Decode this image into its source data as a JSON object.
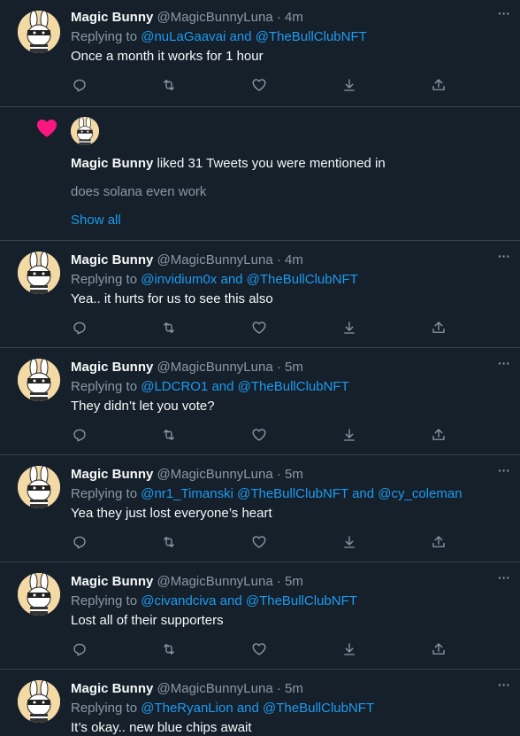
{
  "tweets": [
    {
      "name": "Magic Bunny",
      "handle": "@MagicBunnyLuna",
      "dot": " · ",
      "time": "4m",
      "replying_prefix": "Replying to ",
      "replying_to": "@nuLaGaavai and @TheBullClubNFT",
      "text": "Once a month it works for 1 hour"
    },
    {
      "name": "Magic Bunny",
      "handle": "@MagicBunnyLuna",
      "dot": " · ",
      "time": "4m",
      "replying_prefix": "Replying to ",
      "replying_to": "@invidium0x and @TheBullClubNFT",
      "text": "Yea.. it hurts for us to see this also"
    },
    {
      "name": "Magic Bunny",
      "handle": "@MagicBunnyLuna",
      "dot": " · ",
      "time": "5m",
      "replying_prefix": "Replying to ",
      "replying_to": "@LDCRO1 and @TheBullClubNFT",
      "text": "They didn’t let you vote?"
    },
    {
      "name": "Magic Bunny",
      "handle": "@MagicBunnyLuna",
      "dot": " · ",
      "time": "5m",
      "replying_prefix": "Replying to ",
      "replying_to": "@nr1_Timanski @TheBullClubNFT and @cy_coleman",
      "text": "Yea they just lost everyone’s heart"
    },
    {
      "name": "Magic Bunny",
      "handle": "@MagicBunnyLuna",
      "dot": " · ",
      "time": "5m",
      "replying_prefix": "Replying to ",
      "replying_to": "@civandciva and @TheBullClubNFT",
      "text": "Lost all of their supporters"
    },
    {
      "name": "Magic Bunny",
      "handle": "@MagicBunnyLuna",
      "dot": " · ",
      "time": "5m",
      "replying_prefix": "Replying to ",
      "replying_to": "@TheRyanLion and @TheBullClubNFT",
      "text": "It’s okay.. new blue chips await"
    }
  ],
  "notification": {
    "name": "Magic Bunny",
    "action": " liked 31 Tweets you were mentioned in",
    "snippet": "does solana even work",
    "show_all": "Show all"
  },
  "more_label": "···",
  "icons": {
    "reply": "reply-icon",
    "retweet": "retweet-icon",
    "like": "like-icon",
    "download": "download-icon",
    "share": "share-icon",
    "liked_heart": "heart-icon"
  },
  "colors": {
    "background": "#15202b",
    "border": "#38444d",
    "text": "#f7f9f9",
    "secondary": "#8b98a5",
    "link": "#1d9bf0",
    "heart": "#f91880"
  }
}
